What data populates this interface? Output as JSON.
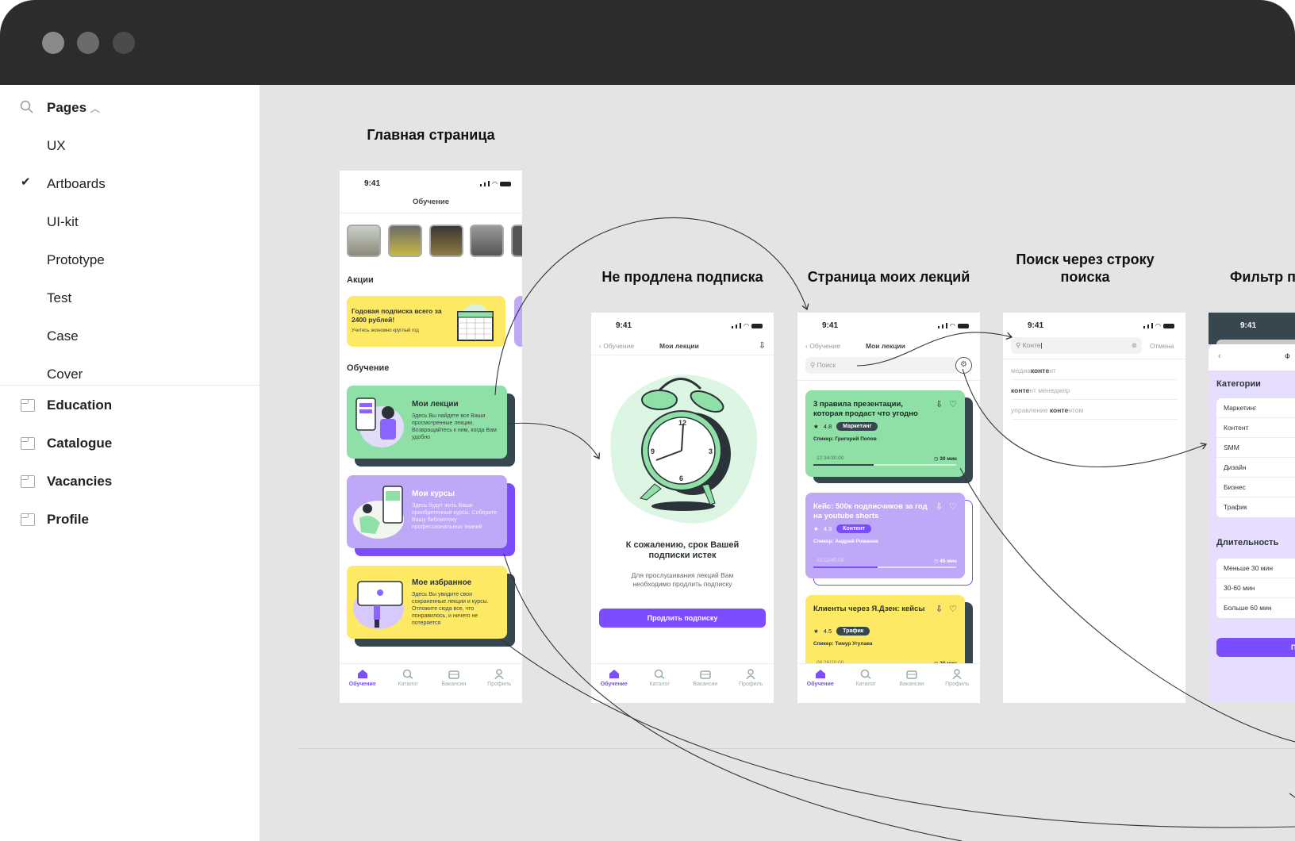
{
  "window": {
    "traffic_lights": [
      "#8a8a8a",
      "#6b6b6b",
      "#4b4b4b"
    ]
  },
  "sidebar": {
    "pages_label": "Pages",
    "pages": [
      {
        "label": "UX",
        "checked": false
      },
      {
        "label": "Artboards",
        "checked": true
      },
      {
        "label": "UI-kit",
        "checked": false
      },
      {
        "label": "Prototype",
        "checked": false
      },
      {
        "label": "Test",
        "checked": false
      },
      {
        "label": "Case",
        "checked": false
      },
      {
        "label": "Cover",
        "checked": false
      }
    ],
    "artboards": [
      "Education",
      "Catalogue",
      "Vacancies",
      "Profile"
    ]
  },
  "canvas": {
    "titles": {
      "main": "Главная страница",
      "expired": "Не продлена подписка",
      "my_lectures": "Страница моих лекций",
      "search_line1": "Поиск через строку",
      "search_line2": "поиска",
      "filter": "Фильтр п"
    }
  },
  "colors": {
    "green": "#8EE0A6",
    "purple": "#BFA8F8",
    "accent": "#7B4DFF",
    "yellow": "#FDE964",
    "dark": "#37474F",
    "canvas": "#E4E4E4"
  },
  "status_time": "9:41",
  "tabbar": [
    "Обучение",
    "Каталог",
    "Вакансии",
    "Профиль"
  ],
  "home": {
    "header": "Обучение",
    "promo_heading": "Акции",
    "promo_title": "Годовая подписка всего за 2400 рублей!",
    "promo_sub": "Учитесь экономно круглый год",
    "section": "Обучение",
    "cards": [
      {
        "title": "Мои лекции",
        "desc": "Здесь Вы найдете все Ваши просмотренные лекции. Возвращайтесь к ним, когда Вам удобно"
      },
      {
        "title": "Мои курсы",
        "desc": "Здесь будут жить Ваши приобретенные курсы. Соберите Вашу библиотеку профессиональных знаний"
      },
      {
        "title": "Мое избранное",
        "desc": "Здесь Вы увидите свои сохраненные лекции и курсы. Отложите сюда все, что понравилось, и ничего не потеряется"
      }
    ]
  },
  "expired": {
    "back": "Обучение",
    "title": "Мои лекции",
    "heading": "К сожалению, срок Вашей подписки истек",
    "text": "Для прослушивания лекций Вам необходимо продлить подписку",
    "button": "Продлить подписку"
  },
  "lectures": {
    "back": "Обучение",
    "title": "Мои лекции",
    "search_placeholder": "Поиск",
    "items": [
      {
        "title": "3 правила презентации, которая продаст что угодно",
        "rating": "4.8",
        "tag": "Маркетинг",
        "speaker": "Спикер: Григорий Попов",
        "time": "12:34/30:00",
        "duration": "30 мин",
        "progress": 0.42
      },
      {
        "title": "Кейс: 500к подписчиков за год на youtube shorts",
        "rating": "4.3",
        "tag": "Контент",
        "speaker": "Спикер: Андрей Романов",
        "time": "20:12/45:00",
        "duration": "45 мин",
        "progress": 0.45
      },
      {
        "title": "Клиенты через Я.Дзен: кейсы",
        "rating": "4.5",
        "tag": "Трафик",
        "speaker": "Спикер: Тимур Угулава",
        "time": "08:26/20:00",
        "duration": "20 мин",
        "progress": 0.4
      }
    ]
  },
  "search": {
    "query": "Конте",
    "cancel": "Отмена",
    "suggestions": [
      {
        "pre": "медиа",
        "bold": "конте",
        "post": "нт"
      },
      {
        "pre": "",
        "bold": "конте",
        "post": "нт менеджер"
      },
      {
        "pre": "управление ",
        "bold": "конте",
        "post": "нтом"
      }
    ]
  },
  "filter": {
    "categories_label": "Категории",
    "categories": [
      "Маркетинг",
      "Контент",
      "SMM",
      "Дизайн",
      "Бизнес",
      "Трафик"
    ],
    "duration_label": "Длительность",
    "durations": [
      "Меньше 30 мин",
      "30-60 мин",
      "Больше 60 мин"
    ],
    "button": "Пр"
  }
}
